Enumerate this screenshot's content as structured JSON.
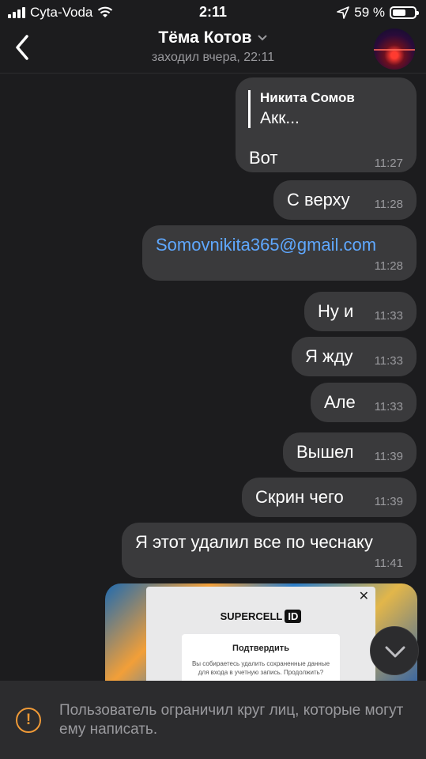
{
  "status_bar": {
    "carrier": "Cyta-Voda",
    "time": "2:11",
    "battery": "59 %",
    "battery_level": 0.59
  },
  "header": {
    "contact_name": "Тёма Котов",
    "last_seen": "заходил вчера, 22:11"
  },
  "messages": [
    {
      "reply_author": "Никита Сомов",
      "reply_text": "Акк...",
      "text": "Вот",
      "time": "11:27"
    },
    {
      "text": "С верху",
      "time": "11:28"
    },
    {
      "text": "Somovnikita365@gmail.com",
      "time": "11:28"
    },
    {
      "text": "Ну и",
      "time": "11:33"
    },
    {
      "text": "Я жду",
      "time": "11:33"
    },
    {
      "text": "Але",
      "time": "11:33"
    },
    {
      "text": "Вышел",
      "time": "11:39"
    },
    {
      "text": "Скрин чего",
      "time": "11:39"
    },
    {
      "text": "Я этот удалил все по чеснаку",
      "time": "11:41"
    }
  ],
  "image_message": {
    "brand": "SUPERCELL",
    "brand_badge": "ID",
    "dialog_title": "Подтвердить",
    "dialog_body": "Вы собираетесь удалить сохраненные данные для входа в учетную запись. Продолжить?",
    "close_symbol": "✕"
  },
  "footer": {
    "notice": "Пользователь ограничил круг лиц, которые могут ему написать."
  },
  "colors": {
    "background": "#1c1c1e",
    "bubble": "#3a3a3c",
    "link": "#5fa8ff",
    "warning": "#f09a37"
  }
}
